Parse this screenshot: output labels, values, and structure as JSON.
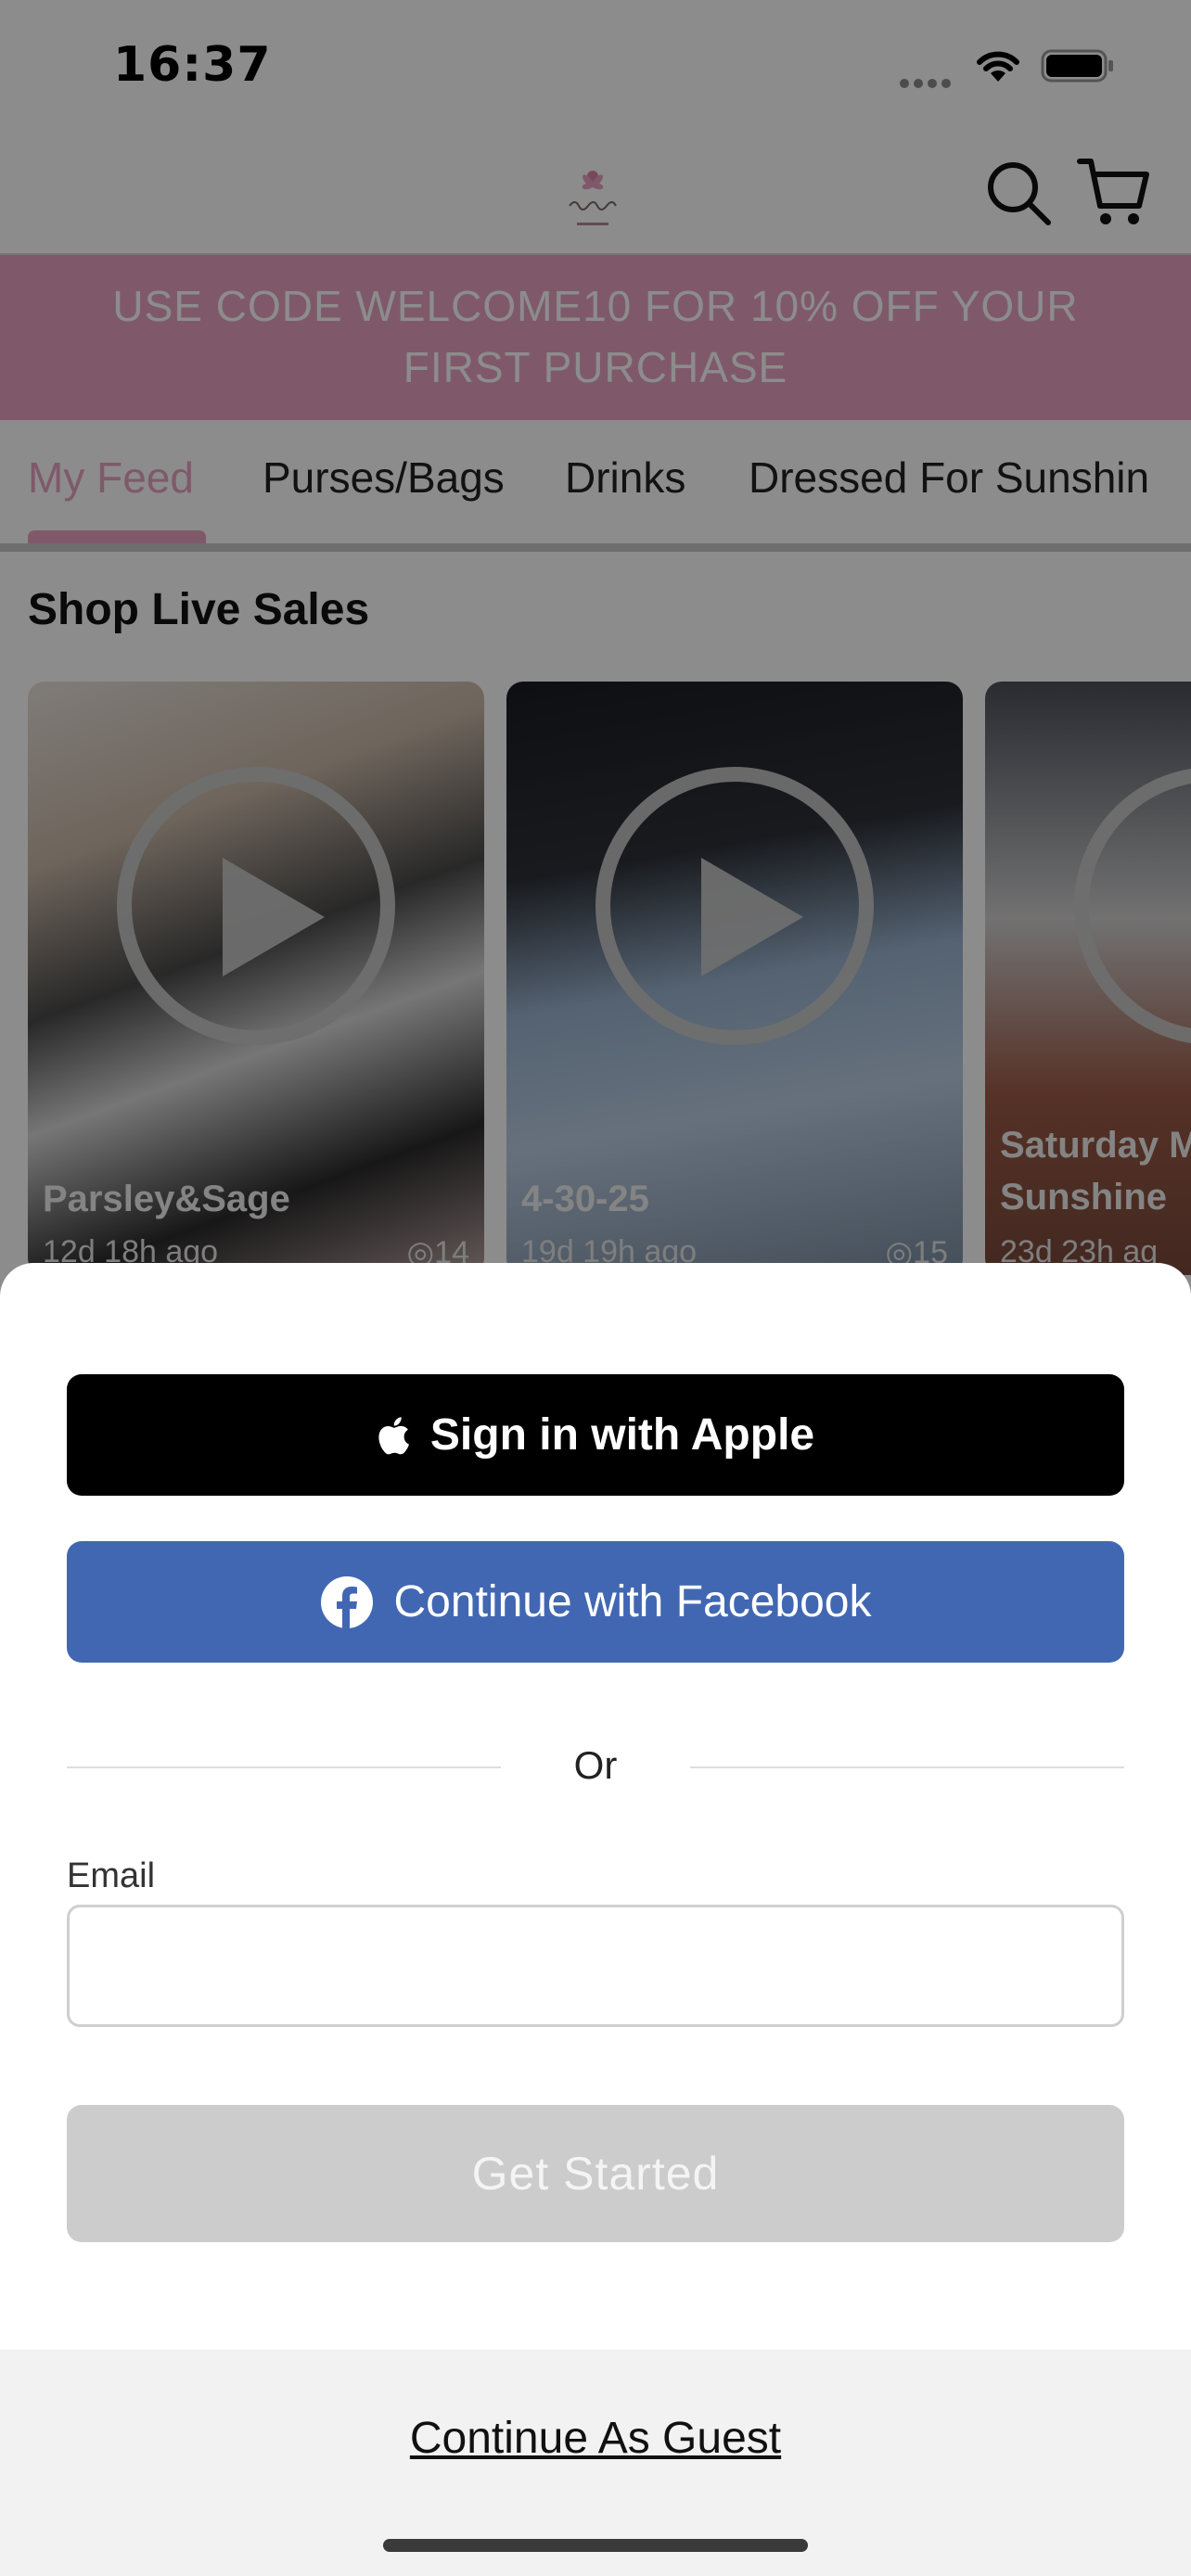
{
  "status_bar": {
    "time": "16:37"
  },
  "header": {
    "logo_icon": "ladies-room-boutique-logo",
    "search_icon": "search-icon",
    "cart_icon": "cart-icon"
  },
  "promo": {
    "line1": "USE CODE WELCOME10 FOR 10% OFF YOUR",
    "line2": "FIRST PURCHASE"
  },
  "tabs": [
    {
      "label": "My Feed",
      "active": true
    },
    {
      "label": "Purses/Bags"
    },
    {
      "label": "Drinks"
    },
    {
      "label": "Dressed For Sunshin"
    }
  ],
  "live_sales": {
    "title": "Shop Live Sales",
    "cards": [
      {
        "title": "Parsley&Sage",
        "time": "12d 18h ago",
        "views": "14"
      },
      {
        "title": "4-30-25",
        "time": "19d 19h ago",
        "views": "15"
      },
      {
        "title_line1": "Saturday M",
        "title_line2": "Sunshine",
        "time": "23d 23h ag"
      }
    ]
  },
  "sheet": {
    "apple_label": "Sign in with Apple",
    "facebook_label": "Continue with Facebook",
    "divider_text": "Or",
    "email_label": "Email",
    "email_value": "",
    "get_started_label": "Get Started",
    "guest_label": "Continue As Guest"
  },
  "colors": {
    "brand_pink": "#e8a3c1",
    "facebook_blue": "#4267b2",
    "apple_black": "#000000",
    "disabled_gray": "#cccccc"
  }
}
